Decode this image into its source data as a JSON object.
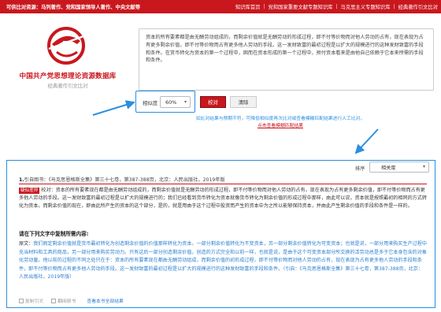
{
  "topbar": {
    "lead_label": "可供比对资源：",
    "lead_items": "马列著作、党和国家领导人著作、中央文献等",
    "nav": [
      "知识库首页",
      "党和国家重要文献专题知识库",
      "马克思主义专题知识库",
      "经典著作引文比对"
    ]
  },
  "brand": {
    "title": "中国共产党思想理论资源数据库",
    "subtitle": "经典著作引文比对"
  },
  "query": {
    "text": "资本的所有要素都是由无酬劳动组成的，而剩余价值就是无酬劳动的形成过程，即不付等价物而对他人劳动的占有，现在表现为占有更多剩余价值，即不付等价物而占有更多他人劳动的手段。这一发财致富的最初过程是以扩大的规模进行的这种发财致富的手段和条件。在货币转化为资本的第一个过程中，固而在资本形成的第一个过程中，预付资本看来是由他自己依赖于它本来所需的手段和条件。"
  },
  "controls": {
    "similarity_label": "相似度",
    "similarity_value": "60%",
    "check_label": "校对",
    "clear_label": "清除",
    "hint_note": "如比对结果与预期不符，可降低相似度再次比对或查看模糊匹配结果进行人工比对。",
    "hint_link": "点击查看模糊匹配结果"
  },
  "results": {
    "sort_label": "排序",
    "sort_value": "相关度",
    "citation_index": "1.",
    "citation": "引自图书：《马克思恩格斯全集》第三十七卷，第387-388页，北京：人民出版社，2019年版",
    "match_tag": "疑似差异",
    "paragraph": "校对：资本的所有要素现在都是由无酬劳动组成的，而剩余价值就是无酬劳动的形成过程，即不付等价物而对他人劳动的占有，现在表现为占有更多剩余价值，即不付等价物而占有更多他人劳动的手段。这一发财致富的最初过程是以扩大的规模进行的；我们已经看到货币转化为资本就像货币转化为剩余价值的形成过程中那样，由此可以说，资本就是按照最初的相同的方式转化为资本。而剩余价值的现在，即由此所产生的资本的这个部分，是的，就是用由于这个过程中投资而产生的资本中为之所以能够保持资本，并由此产生剩余价值的手段和条件是一样的。",
    "question_title": "请在下列文字中复制所需内容:",
    "source_label": "原文：",
    "source_text": "我们假定剩余价值就是货币最初转化为创造剩余价值的价值那样转化为资本。一部分剩余价值转化为不变资本，另一部分剩余价值转化为可变资本；也就是说，一部分用来购买生产过程中充当材料和工具的商品，另一部分用来购买劳动力。只有这后一部分创造剩余价值，创造的方式完全和以前一样，也就是说，是由于这个可变资本部分所交换的活劳动总是多于它本身包含的对象化劳动量。他以前的过程的不同之处只在于：资本的所有要素现在都由无酬劳动组成，而剩余价值的初形成过程，即不付等价物而对他人劳动的占有，现在表现为占有更多他人劳动的手段和条件，即不付等价物而占有更多他人劳动的手段。这一发财致富的最初过程是以扩大的规模进行的这种发财致富的手段和条件。（引自：《马克思恩格斯全集》第三十七卷，第387-388页，北京：人民出版社，2019年版）",
    "actions": [
      "复制引文",
      "翻阅原书",
      "查看本书全部结果"
    ]
  },
  "colors": {
    "brand_red": "#c9171e",
    "highlight_blue": "#2a8fe0",
    "link_blue": "#2a7fd0"
  },
  "icons": [
    "logo-emblem-icon",
    "caret-down-icon",
    "arrow-annotation-icon",
    "checkbox-icon"
  ]
}
